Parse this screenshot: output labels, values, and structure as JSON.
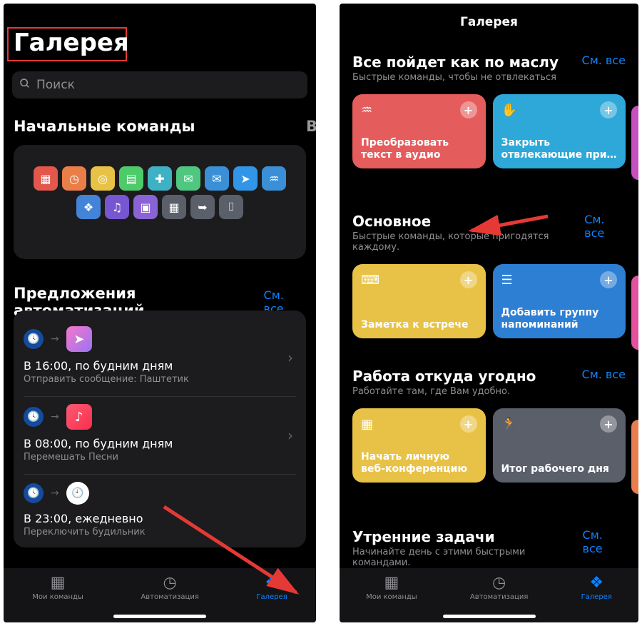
{
  "left": {
    "title": "Галерея",
    "search_placeholder": "Поиск",
    "starter_section": "Начальные команды",
    "partial_next": "В",
    "auto_section": "Предложения автоматизаций",
    "see_all": "См. все",
    "auto": [
      {
        "title": "В 16:00, по будним дням",
        "sub": "Отправить сообщение: Паштетик"
      },
      {
        "title": "В 08:00, по будним дням",
        "sub": "Перемешать Песни"
      },
      {
        "title": "В 23:00, ежедневно",
        "sub": "Переключить будильник"
      }
    ]
  },
  "right": {
    "nav": "Галерея",
    "see_all": "См. все",
    "sections": [
      {
        "title": "Все пойдет как по маслу",
        "sub": "Быстрые команды, чтобы не отвлекаться",
        "cards": [
          {
            "label": "Преобразовать текст в аудио",
            "color": "#e55c5c",
            "icon": "audio-wave-icon"
          },
          {
            "label": "Закрыть отвлекающие при…",
            "color": "#2ea8d9",
            "icon": "hand-icon"
          }
        ],
        "sliver": "#c84fbf"
      },
      {
        "title": "Основное",
        "sub": "Быстрые команды, которые пригодятся каждому.",
        "cards": [
          {
            "label": "Заметка к встрече",
            "color": "#e8c246",
            "icon": "keyboard-icon"
          },
          {
            "label": "Добавить группу напоминаний",
            "color": "#2d7fd3",
            "icon": "list-icon"
          }
        ],
        "sliver": "#e5519f"
      },
      {
        "title": "Работа откуда угодно",
        "sub": "Работайте там, где Вам удобно.",
        "cards": [
          {
            "label": "Начать личную веб-конференцию",
            "color": "#e8c246",
            "icon": "calendar-icon"
          },
          {
            "label": "Итог рабочего дня",
            "color": "#5a5f6a",
            "icon": "running-icon"
          }
        ],
        "sliver": "#e87e4d"
      },
      {
        "title": "Утренние задачи",
        "sub": "Начинайте день с этими быстрыми командами."
      }
    ]
  },
  "tabs": [
    {
      "label": "Мои команды"
    },
    {
      "label": "Автоматизация"
    },
    {
      "label": "Галерея"
    }
  ]
}
